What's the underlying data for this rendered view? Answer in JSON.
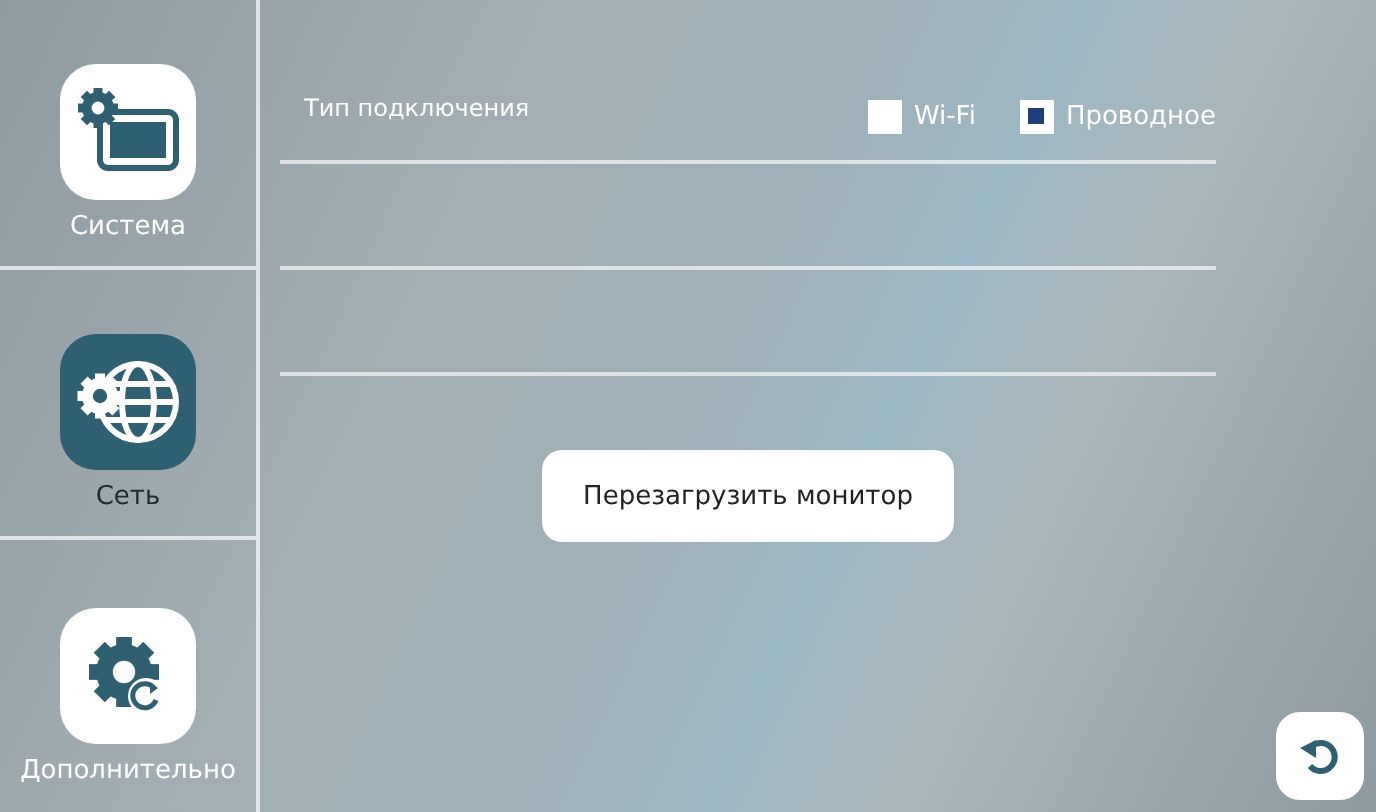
{
  "sidebar": {
    "items": [
      {
        "label": "Система",
        "kind": "system",
        "selected": false
      },
      {
        "label": "Сеть",
        "kind": "network",
        "selected": true
      },
      {
        "label": "Дополнительно",
        "kind": "advanced",
        "selected": false
      }
    ]
  },
  "connection": {
    "label": "Тип подключения",
    "options": [
      {
        "label": "Wi-Fi",
        "selected": false
      },
      {
        "label": "Проводное",
        "selected": true
      }
    ]
  },
  "reboot_button": "Перезагрузить монитор"
}
